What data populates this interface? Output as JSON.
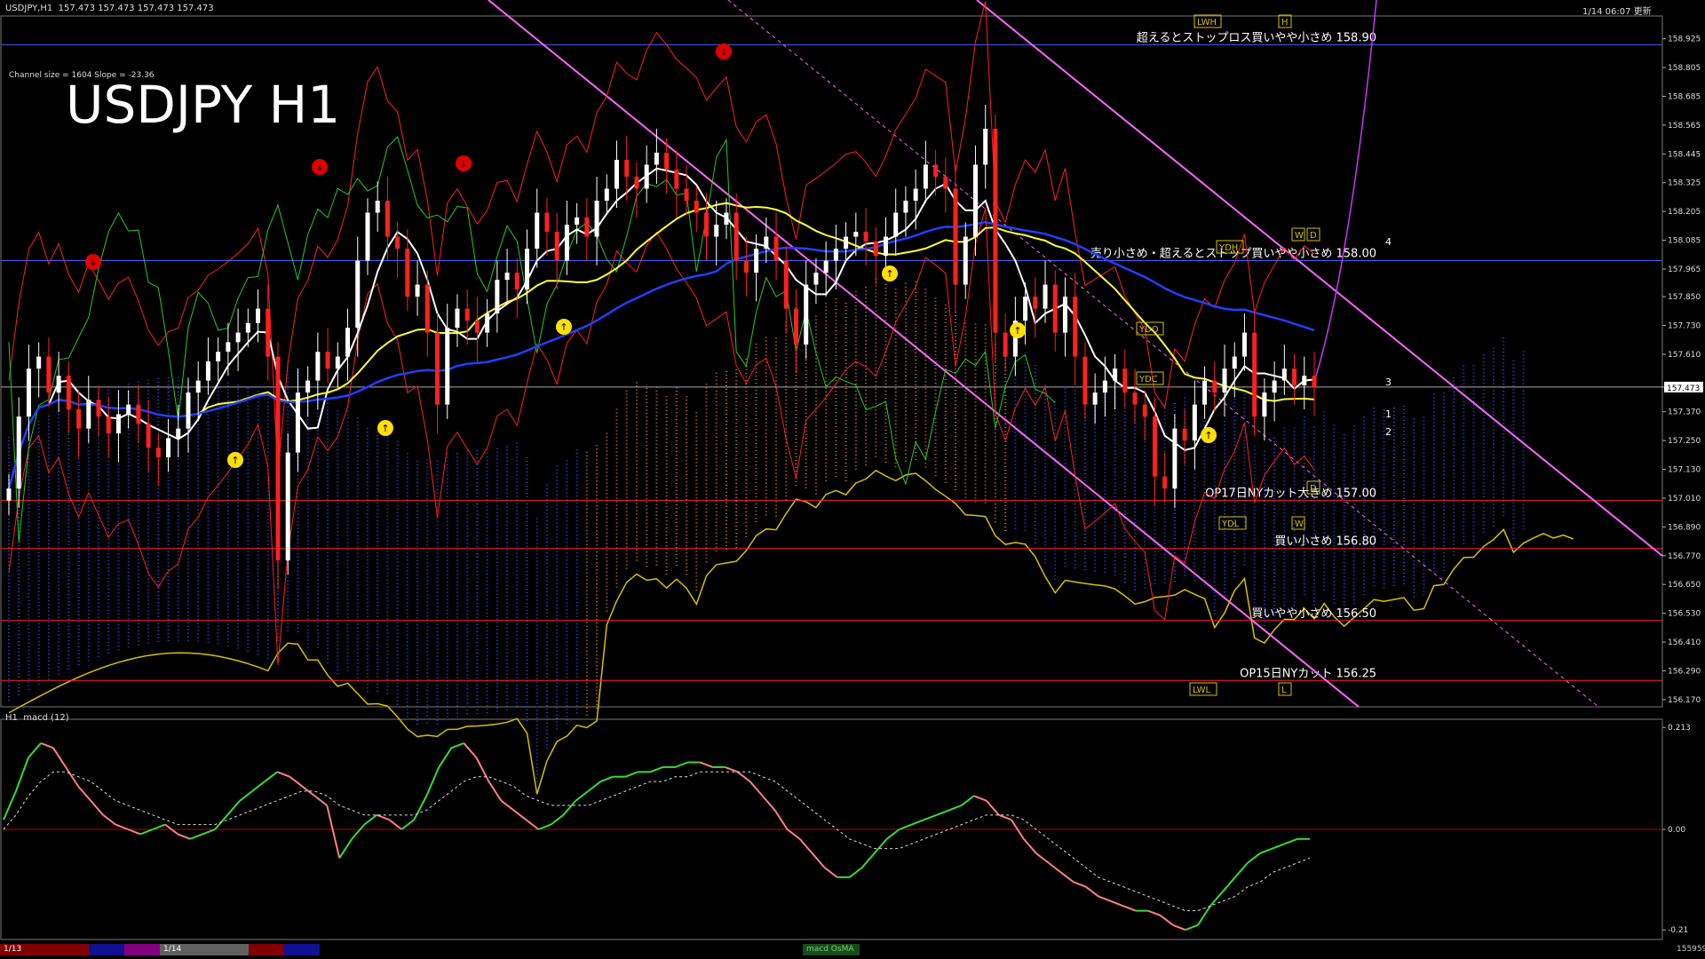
{
  "window": {
    "title": "USDJPY,H1",
    "ohlc": "157.473 157.473 157.473 157.473",
    "top_right": "1/14 06:07 更新"
  },
  "chart": {
    "symbol_title": "USDJPY H1",
    "channel_info": "Channel size = 1604 Slope = -23.36",
    "current_price_label": "157.473",
    "colors": {
      "bull": "#ffffff",
      "bear": "#ff2020",
      "ma_white": "#ffffff",
      "ma_yellow": "#ffff33",
      "ma_blue": "#2040ff",
      "chikou": "#22cc22",
      "envelope": "#ff2020",
      "cloud_blue": "#3050ff",
      "cloud_orange": "#e08040",
      "channel": "#ff66ff",
      "level_line": "#ff2020",
      "blue_line": "#4060ff"
    }
  },
  "chart_data": [
    {
      "type": "line",
      "name": "price",
      "y_axis_ticks": [
        "158.925",
        "158.805",
        "158.685",
        "158.565",
        "158.445",
        "158.325",
        "158.205",
        "158.085",
        "157.965",
        "157.850",
        "157.730",
        "157.610",
        "157.473",
        "157.370",
        "157.250",
        "157.130",
        "157.010",
        "156.890",
        "156.770",
        "156.650",
        "156.530",
        "156.410",
        "156.290",
        "156.170"
      ],
      "ylim": [
        156.14,
        159.02
      ],
      "close": [
        157.05,
        157.35,
        157.55,
        157.6,
        157.45,
        157.52,
        157.38,
        157.3,
        157.42,
        157.35,
        157.28,
        157.36,
        157.4,
        157.32,
        157.22,
        157.18,
        157.26,
        157.3,
        157.45,
        157.5,
        157.58,
        157.62,
        157.66,
        157.7,
        157.74,
        157.8,
        157.6,
        156.75,
        157.2,
        157.45,
        157.5,
        157.62,
        157.55,
        157.6,
        157.72,
        158.0,
        158.2,
        158.25,
        158.1,
        158.05,
        157.85,
        157.9,
        157.7,
        157.4,
        157.72,
        157.8,
        157.75,
        157.7,
        157.78,
        157.92,
        157.95,
        157.88,
        158.05,
        158.2,
        158.12,
        158.0,
        158.15,
        158.18,
        158.1,
        158.25,
        158.3,
        158.42,
        158.35,
        158.3,
        158.4,
        158.45,
        158.38,
        158.3,
        158.25,
        158.2,
        158.1,
        158.15,
        158.2,
        158.0,
        157.95,
        158.05,
        158.1,
        158.0,
        157.8,
        157.65,
        157.9,
        157.95,
        158.0,
        158.05,
        158.1,
        158.12,
        158.08,
        158.02,
        158.1,
        158.2,
        158.25,
        158.3,
        158.4,
        158.35,
        158.3,
        157.9,
        158.1,
        158.4,
        158.55,
        157.7,
        157.6,
        157.75,
        157.85,
        157.8,
        157.9,
        157.7,
        157.85,
        157.6,
        157.4,
        157.45,
        157.5,
        157.55,
        157.45,
        157.4,
        157.35,
        157.1,
        157.05,
        157.3,
        157.25,
        157.4,
        157.5,
        157.45,
        157.55,
        157.6,
        157.7,
        157.35,
        157.45,
        157.5,
        157.55,
        157.48,
        157.52,
        157.473
      ],
      "levels": [
        {
          "price": 158.9,
          "label": "超えるとストップロス買いやや小さめ 158.90"
        },
        {
          "price": 158.0,
          "label": "売り小さめ・超えるとストップ買いやや小さめ 158.00"
        },
        {
          "price": 157.0,
          "label": "OP17日NYカット大きめ 157.00"
        },
        {
          "price": 156.8,
          "label": "買い小さめ 156.80"
        },
        {
          "price": 156.5,
          "label": "買いやや小さめ 156.50"
        },
        {
          "price": 156.25,
          "label": "OP15日NYカット 156.25"
        }
      ],
      "pivot_labels": [
        "LWH",
        "LWL",
        "YDH",
        "YDL",
        "YDO",
        "YDC",
        "D",
        "W",
        "H",
        "L"
      ],
      "target_labels": [
        "4",
        "3",
        "1",
        "2"
      ]
    },
    {
      "type": "line",
      "name": "macd (12)",
      "y_axis_ticks": [
        "0.213",
        "0.00",
        "-0.21"
      ],
      "ylim": [
        -0.23,
        0.23
      ],
      "macd": [
        0.02,
        0.08,
        0.15,
        0.18,
        0.17,
        0.13,
        0.09,
        0.06,
        0.03,
        0.01,
        0.0,
        -0.01,
        0.0,
        0.01,
        -0.01,
        -0.02,
        -0.01,
        0.0,
        0.03,
        0.06,
        0.08,
        0.1,
        0.12,
        0.11,
        0.09,
        0.07,
        0.05,
        -0.06,
        -0.02,
        0.01,
        0.03,
        0.02,
        0.0,
        0.02,
        0.07,
        0.13,
        0.17,
        0.18,
        0.15,
        0.1,
        0.06,
        0.04,
        0.02,
        0.0,
        0.01,
        0.03,
        0.06,
        0.08,
        0.1,
        0.11,
        0.11,
        0.12,
        0.12,
        0.13,
        0.13,
        0.14,
        0.14,
        0.13,
        0.13,
        0.12,
        0.1,
        0.07,
        0.04,
        0.0,
        -0.02,
        -0.05,
        -0.08,
        -0.1,
        -0.1,
        -0.08,
        -0.05,
        -0.02,
        0.0,
        0.01,
        0.02,
        0.03,
        0.04,
        0.05,
        0.07,
        0.06,
        0.03,
        0.02,
        -0.02,
        -0.05,
        -0.07,
        -0.09,
        -0.11,
        -0.12,
        -0.14,
        -0.15,
        -0.16,
        -0.17,
        -0.17,
        -0.18,
        -0.2,
        -0.21,
        -0.2,
        -0.16,
        -0.13,
        -0.1,
        -0.07,
        -0.05,
        -0.04,
        -0.03,
        -0.02,
        -0.02
      ],
      "signal": [
        0.0,
        0.03,
        0.07,
        0.1,
        0.12,
        0.12,
        0.11,
        0.1,
        0.08,
        0.06,
        0.05,
        0.04,
        0.03,
        0.02,
        0.01,
        0.01,
        0.01,
        0.01,
        0.02,
        0.03,
        0.04,
        0.05,
        0.06,
        0.07,
        0.08,
        0.08,
        0.07,
        0.05,
        0.04,
        0.03,
        0.03,
        0.03,
        0.03,
        0.03,
        0.04,
        0.06,
        0.08,
        0.1,
        0.11,
        0.11,
        0.1,
        0.09,
        0.07,
        0.06,
        0.05,
        0.05,
        0.05,
        0.05,
        0.06,
        0.07,
        0.08,
        0.09,
        0.1,
        0.1,
        0.11,
        0.11,
        0.12,
        0.12,
        0.12,
        0.12,
        0.12,
        0.11,
        0.1,
        0.08,
        0.06,
        0.04,
        0.02,
        0.0,
        -0.02,
        -0.03,
        -0.04,
        -0.04,
        -0.04,
        -0.03,
        -0.02,
        -0.01,
        0.0,
        0.01,
        0.02,
        0.03,
        0.03,
        0.03,
        0.02,
        0.0,
        -0.02,
        -0.04,
        -0.06,
        -0.08,
        -0.1,
        -0.11,
        -0.12,
        -0.13,
        -0.14,
        -0.15,
        -0.16,
        -0.17,
        -0.17,
        -0.16,
        -0.15,
        -0.14,
        -0.12,
        -0.11,
        -0.09,
        -0.08,
        -0.07,
        -0.06
      ]
    }
  ],
  "bottom_bar": {
    "date_1": "1/13",
    "date_2": "1/14",
    "indicator_tab": "macd OsMA",
    "right_value": "155959"
  }
}
